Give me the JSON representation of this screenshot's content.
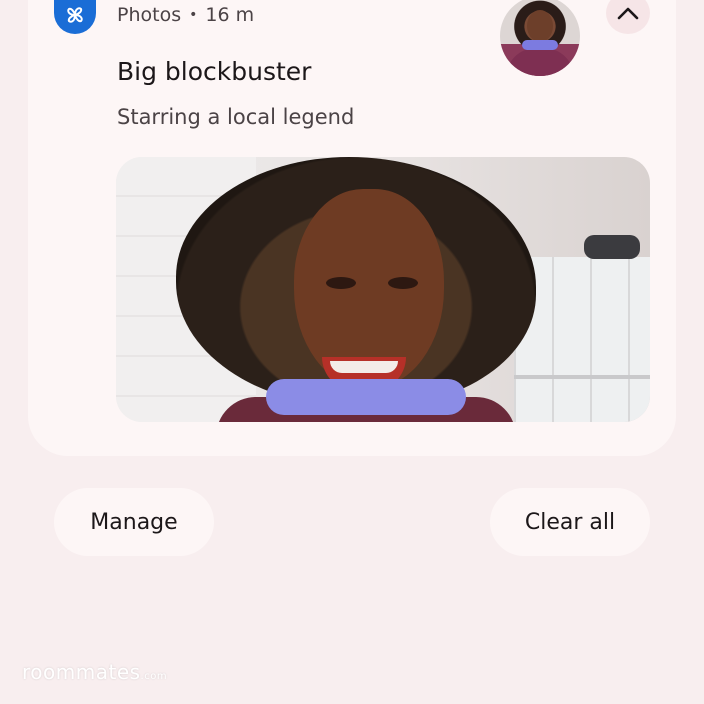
{
  "notification": {
    "app_name": "Photos",
    "separator": "•",
    "time": "16 m",
    "title": "Big blockbuster",
    "subtitle": "Starring a local legend",
    "app_icon": "pinwheel-icon",
    "collapse_icon": "chevron-up-icon",
    "accent_color": "#1a6dd6"
  },
  "actions": {
    "manage_label": "Manage",
    "clear_all_label": "Clear all"
  },
  "watermark": {
    "text": "roommates",
    "suffix": ".com"
  }
}
